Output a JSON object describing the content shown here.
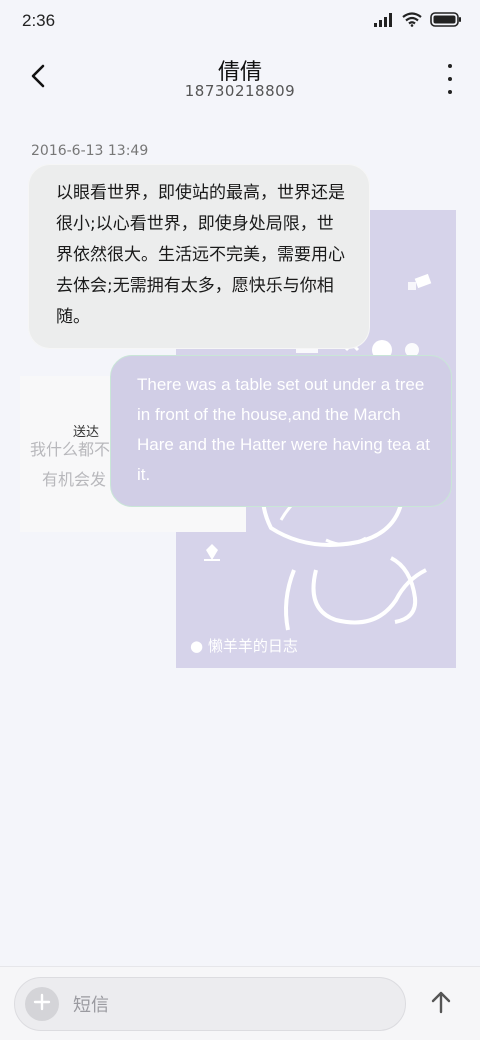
{
  "status_bar": {
    "time": "2:36",
    "icons": [
      "signal-icon",
      "wifi-icon",
      "battery-icon"
    ]
  },
  "header": {
    "back_icon": "back-arrow-icon",
    "contact_name": "倩倩",
    "contact_number": "18730218809",
    "more_icon": "more-vertical-icon"
  },
  "conversation": {
    "timestamp": "2016-6-13 13:49",
    "incoming_message": "以眼看世界，即使站的最高，世界还是很小;以心看世界，即使身处局限，世界依然很大。生活远不完美，需要用心去体会;无需拥有太多，愿快乐与你相随。",
    "outgoing_message": "There was a table set out under a tree in front of the house,and the March Hare and the Hatter were having tea at it.",
    "delivery_status": "送达",
    "background_picture_caption": "● 懒羊羊的日志",
    "background_note_lines": [
      "我什么都不",
      "有机会发"
    ]
  },
  "composer": {
    "add_icon": "plus-icon",
    "placeholder": "短信",
    "send_icon": "send-arrow-up-icon"
  },
  "colors": {
    "background": "#f4f5fa",
    "incoming_bubble": "#eceded",
    "outgoing_bubble": "#d1cee6",
    "picture_background": "#d6d3ea"
  }
}
